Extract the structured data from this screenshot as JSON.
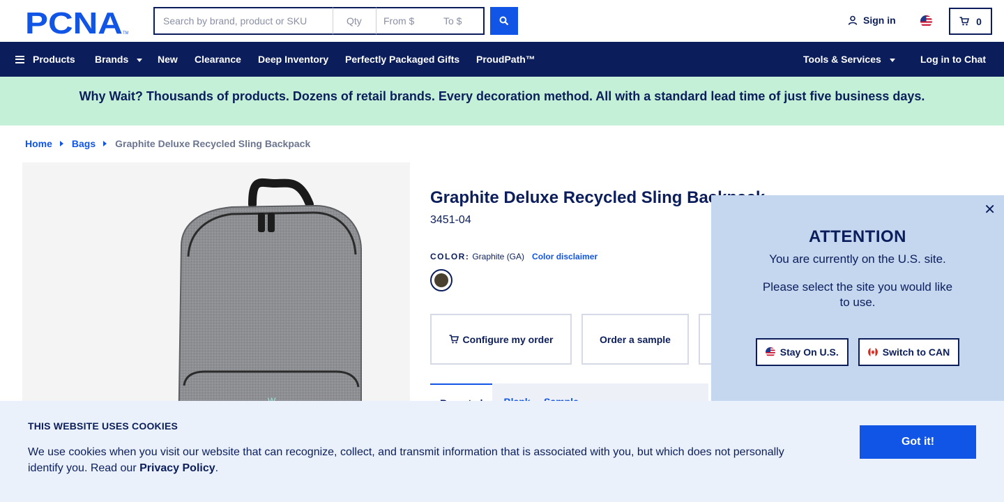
{
  "header": {
    "logo_text": "PCNA",
    "search": {
      "placeholder": "Search by brand, product or SKU",
      "value": ""
    },
    "qty": {
      "placeholder": "Qty"
    },
    "price_from": {
      "placeholder": "From $"
    },
    "price_to": {
      "placeholder": "To $"
    },
    "signin_label": "Sign in",
    "cart_count": "0"
  },
  "nav": {
    "items": [
      {
        "label": "Products"
      },
      {
        "label": "Brands"
      },
      {
        "label": "New"
      },
      {
        "label": "Clearance"
      },
      {
        "label": "Deep Inventory"
      },
      {
        "label": "Perfectly Packaged Gifts"
      },
      {
        "label": "ProudPath™"
      },
      {
        "label": "Tools & Services"
      },
      {
        "label": "Log in to Chat"
      }
    ]
  },
  "banner": {
    "text": "Why Wait? Thousands of products. Dozens of retail brands. Every decoration method. All with a standard lead time of just five business days."
  },
  "breadcrumb": {
    "items": [
      {
        "label": "Home"
      },
      {
        "label": "Bags"
      },
      {
        "label": "Graphite Deluxe Recycled Sling Backpack"
      }
    ]
  },
  "product": {
    "title": "Graphite Deluxe Recycled Sling Backpack",
    "sku": "3451-04",
    "color_label": "COLOR:",
    "color_value": "Graphite (GA)",
    "color_disclaimer": "Color disclaimer",
    "swatch_color": "#4a4030",
    "actions": [
      {
        "label": "Configure my order"
      },
      {
        "label": "Order a sample"
      }
    ],
    "tabs": [
      {
        "label": "Reported"
      },
      {
        "label": "Blank ... Sample"
      }
    ]
  },
  "site_popup": {
    "heading": "ATTENTION",
    "text": "You are currently on the U.S. site.",
    "prompt": "Please select the site you would like to use.",
    "stay_label": "Stay On U.S.",
    "switch_label": "Switch to CAN"
  },
  "cookie": {
    "title": "THIS WEBSITE USES COOKIES",
    "text": "We use cookies when you visit our website that can recognize, collect, and transmit information that is associated with you, but which does not personally identify you. Read our",
    "link": "Privacy Policy",
    "period": ".",
    "button": "Got it!"
  },
  "colors": {
    "navy": "#0b1e5b",
    "accent_blue": "#1055e6",
    "banner_green": "#c3f0d7",
    "popup_blue": "#c5d6ef",
    "cookie_bg": "#eaf1fb"
  }
}
